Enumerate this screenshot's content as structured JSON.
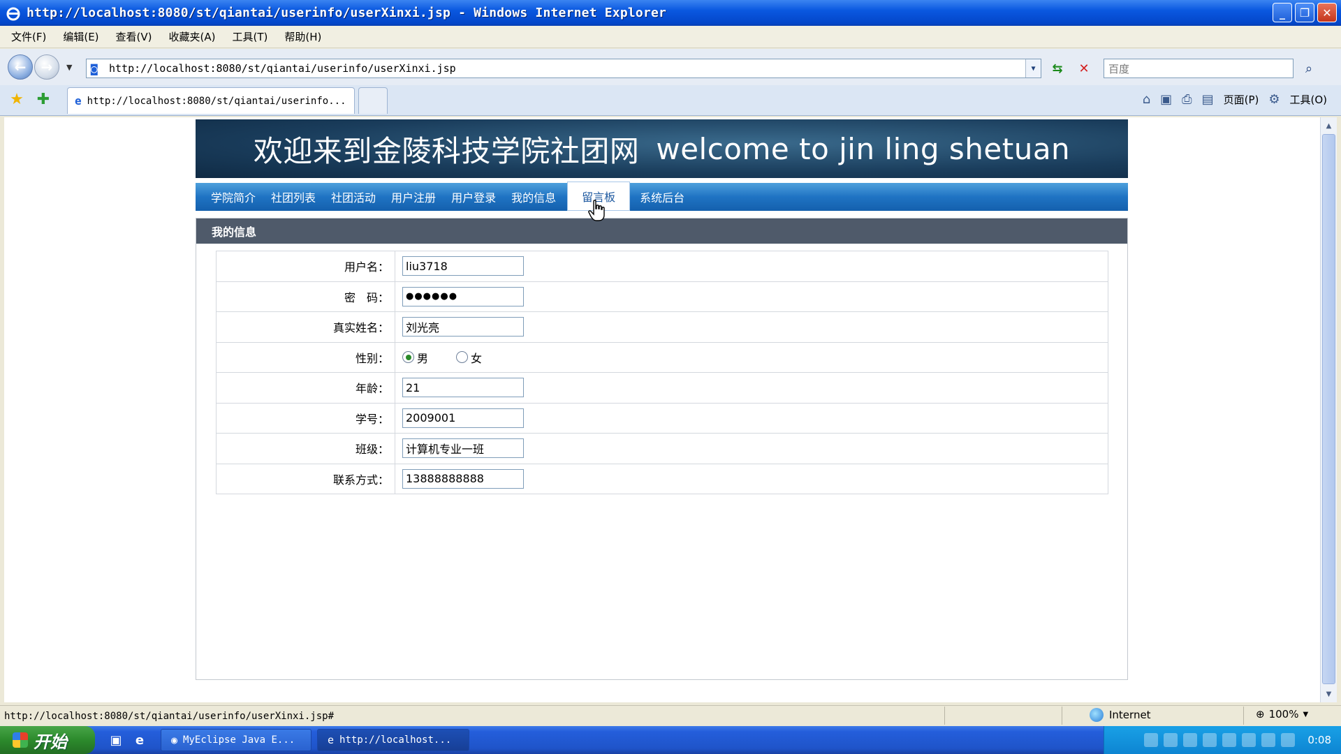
{
  "window": {
    "title": "http://localhost:8080/st/qiantai/userinfo/userXinxi.jsp - Windows Internet Explorer",
    "min": "_",
    "max": "❐",
    "close": "✕"
  },
  "menu": [
    "文件(F)",
    "编辑(E)",
    "查看(V)",
    "收藏夹(A)",
    "工具(T)",
    "帮助(H)"
  ],
  "address": {
    "url": "http://localhost:8080/st/qiantai/userinfo/userXinxi.jsp",
    "search_placeholder": "百度"
  },
  "tab": {
    "label": "http://localhost:8080/st/qiantai/userinfo..."
  },
  "commandbar": {
    "page": "页面(P)",
    "tools": "工具(O)"
  },
  "site": {
    "banner_cn": "欢迎来到金陵科技学院社团网",
    "banner_en": "welcome to jin ling shetuan",
    "nav": [
      "学院简介",
      "社团列表",
      "社团活动",
      "用户注册",
      "用户登录",
      "我的信息",
      "留言板",
      "系统后台"
    ],
    "active_nav_index": 6,
    "section_title": "我的信息",
    "form": {
      "username_label": "用户名：",
      "username": "liu3718",
      "password_label": "密　码：",
      "password": "●●●●●●",
      "realname_label": "真实姓名：",
      "realname": "刘光亮",
      "gender_label": "性别：",
      "gender_male": "男",
      "gender_female": "女",
      "age_label": "年龄：",
      "age": "21",
      "student_id_label": "学号：",
      "student_id": "2009001",
      "class_label": "班级：",
      "class": "计算机专业一班",
      "contact_label": "联系方式：",
      "contact": "13888888888"
    }
  },
  "status": {
    "url": "http://localhost:8080/st/qiantai/userinfo/userXinxi.jsp#",
    "zone": "Internet",
    "zoom": "100%"
  },
  "taskbar": {
    "start": "开始",
    "tasks": [
      "MyEclipse Java E...",
      "http://localhost..."
    ],
    "time": "0:08"
  },
  "colors": {
    "nav_blue": "#1f73c3",
    "section_head": "#4f5a6a",
    "banner": "#1a3d5c"
  }
}
